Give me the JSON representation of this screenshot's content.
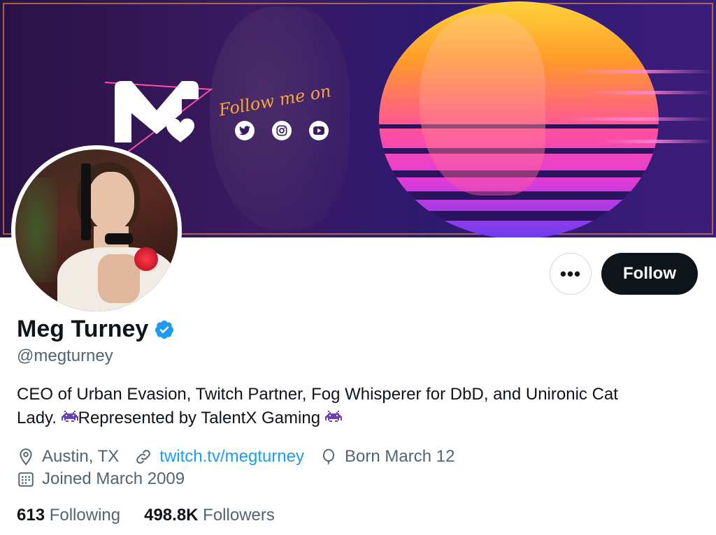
{
  "banner": {
    "follow_text": "Follow me on",
    "socials": [
      "twitter-icon",
      "instagram-icon",
      "youtube-icon"
    ],
    "colors": {
      "bg": "#2a1245",
      "accent": "#f6a63a",
      "sun_top": "#ffd23a",
      "sun_bottom": "#6b3cf0"
    }
  },
  "actions": {
    "more_label": "•••",
    "follow_label": "Follow"
  },
  "profile": {
    "name": "Meg Turney",
    "handle": "@megturney",
    "bio_line1": "CEO of Urban Evasion, Twitch Partner, Fog Whisperer for DbD, and Unironic Cat",
    "bio_line2_a": "Lady. ",
    "bio_line2_b": "Represented by TalentX Gaming ",
    "location": "Austin, TX",
    "website": "twitch.tv/megturney",
    "birthday": "Born March 12",
    "joined": "Joined March 2009"
  },
  "stats": {
    "following_count": "613",
    "following_label": "Following",
    "followers_count": "498.8K",
    "followers_label": "Followers"
  },
  "colors": {
    "verified": "#1d9bf0",
    "link": "#1d9bf0",
    "muted": "#536471",
    "text": "#0f1419"
  }
}
